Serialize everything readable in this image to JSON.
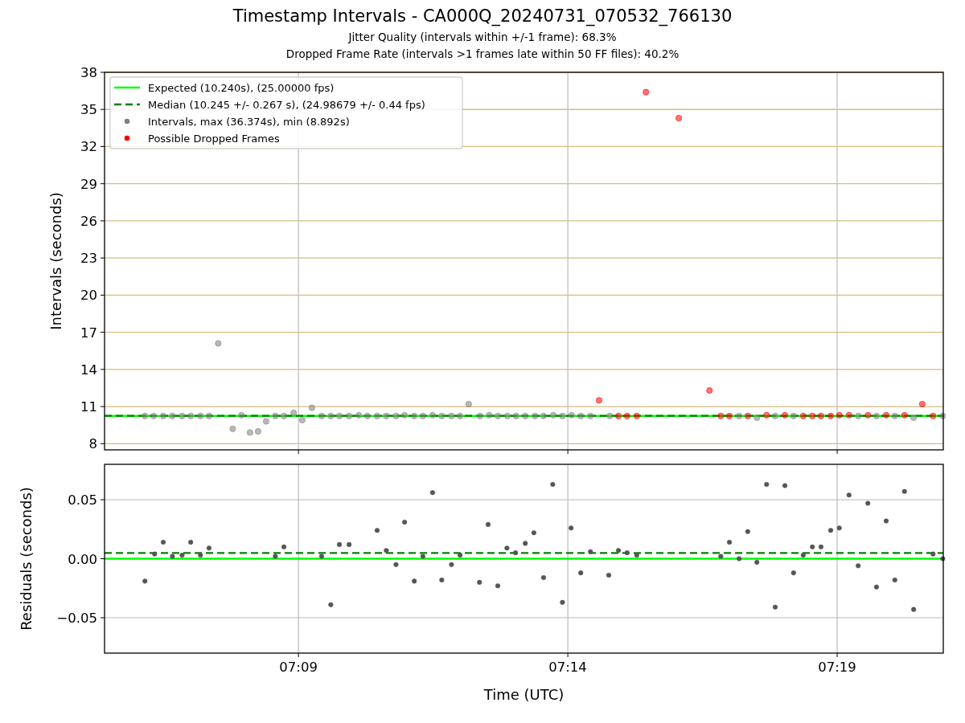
{
  "figure": {
    "title": "Timestamp Intervals - CA000Q_20240731_070532_766130",
    "subtitles": [
      "Jitter Quality (intervals within +/-1 frame): 68.3%",
      "Dropped Frame Rate (intervals >1 frames late within 50 FF files): 40.2%"
    ]
  },
  "panels": [
    {
      "chart_data": {
        "type": "scatter",
        "ylabel": "Intervals (seconds)",
        "grid": true,
        "legend": "upper left",
        "xlim": [
          425.4,
          440.97
        ],
        "ylim": [
          7.5,
          38
        ],
        "yticks": [
          {
            "value": 8,
            "label": "8"
          },
          {
            "value": 11,
            "label": "11"
          },
          {
            "value": 14,
            "label": "14"
          },
          {
            "value": 17,
            "label": "17"
          },
          {
            "value": 20,
            "label": "20"
          },
          {
            "value": 23,
            "label": "23"
          },
          {
            "value": 26,
            "label": "26"
          },
          {
            "value": 29,
            "label": "29"
          },
          {
            "value": 32,
            "label": "32"
          },
          {
            "value": 35,
            "label": "35"
          },
          {
            "value": 38,
            "label": "38"
          }
        ],
        "ref_lines": [
          {
            "axis": "y",
            "value": 10.24,
            "label": "Expected (10.240s), (25.00000 fps)",
            "color": "#00ff00"
          },
          {
            "axis": "y",
            "value": 10.245,
            "label": "Median (10.245 +/- 0.267 s), (24.98679 +/- 0.44 fps)",
            "color": "#008000"
          }
        ],
        "series": [
          {
            "name": "Intervals, max (36.374s), min (8.892s)",
            "color": "#808080",
            "x": [
              426.15,
              426.31,
              426.49,
              426.66,
              426.84,
              427.0,
              427.18,
              427.34,
              427.51,
              427.78,
              427.94,
              428.1,
              428.25,
              428.4,
              428.57,
              428.73,
              428.91,
              429.07,
              429.25,
              429.43,
              429.6,
              429.76,
              429.94,
              430.12,
              430.28,
              430.46,
              430.63,
              430.81,
              430.97,
              431.15,
              431.31,
              431.49,
              431.66,
              431.84,
              432.0,
              432.16,
              432.37,
              432.54,
              432.7,
              432.88,
              433.04,
              433.21,
              433.39,
              433.55,
              433.73,
              433.9,
              434.07,
              434.24,
              434.42,
              434.78,
              437.18,
              437.51,
              437.85,
              438.19,
              439.39,
              439.73,
              440.07,
              440.42,
              440.96
            ],
            "values": [
              10.24,
              10.24,
              10.24,
              10.24,
              10.24,
              10.24,
              10.24,
              10.24,
              16.1,
              9.2,
              10.3,
              8.9,
              9.0,
              9.8,
              10.24,
              10.24,
              10.5,
              9.9,
              10.9,
              10.24,
              10.24,
              10.24,
              10.24,
              10.3,
              10.24,
              10.24,
              10.24,
              10.24,
              10.3,
              10.24,
              10.24,
              10.3,
              10.24,
              10.24,
              10.24,
              11.2,
              10.24,
              10.3,
              10.24,
              10.24,
              10.24,
              10.24,
              10.24,
              10.24,
              10.3,
              10.24,
              10.3,
              10.24,
              10.24,
              10.24,
              10.24,
              10.1,
              10.24,
              10.24,
              10.24,
              10.24,
              10.24,
              10.1,
              10.24
            ]
          },
          {
            "name": "Possible Dropped Frames",
            "color": "#ff0000",
            "x": [
              434.58,
              434.94,
              435.1,
              435.28,
              435.45,
              436.06,
              436.63,
              436.84,
              437.0,
              437.34,
              437.69,
              438.03,
              438.37,
              438.54,
              438.7,
              438.88,
              439.04,
              439.22,
              439.57,
              439.91,
              440.25,
              440.58,
              440.78
            ],
            "values": [
              11.5,
              10.24,
              10.24,
              10.24,
              36.4,
              34.3,
              12.3,
              10.24,
              10.24,
              10.24,
              10.3,
              10.3,
              10.24,
              10.24,
              10.24,
              10.24,
              10.3,
              10.3,
              10.3,
              10.3,
              10.3,
              11.2,
              10.24
            ]
          }
        ]
      }
    },
    {
      "chart_data": {
        "type": "scatter",
        "xlabel": "Time (UTC)",
        "ylabel": "Residuals (seconds)",
        "grid": true,
        "xlim": [
          425.4,
          440.97
        ],
        "ylim": [
          -0.08,
          0.08
        ],
        "xticks": [
          {
            "value": 429,
            "label": "07:09"
          },
          {
            "value": 434,
            "label": "07:14"
          },
          {
            "value": 439,
            "label": "07:19"
          }
        ],
        "yticks": [
          {
            "value": -0.05,
            "label": "−0.05"
          },
          {
            "value": 0,
            "label": "0.00"
          },
          {
            "value": 0.05,
            "label": "0.05"
          }
        ],
        "ref_lines": [
          {
            "axis": "y",
            "value": 0,
            "color": "#00ff00"
          },
          {
            "axis": "y",
            "value": 0.0048,
            "color": "#008000"
          }
        ],
        "series": [
          {
            "color": "#555555",
            "x": [
              426.15,
              426.33,
              426.49,
              426.66,
              426.84,
              427.0,
              427.18,
              427.34,
              428.57,
              428.73,
              429.43,
              429.6,
              429.76,
              429.94,
              430.46,
              430.63,
              430.81,
              430.97,
              431.15,
              431.31,
              431.49,
              431.66,
              431.84,
              432.0,
              432.36,
              432.52,
              432.7,
              432.87,
              433.03,
              433.21,
              433.37,
              433.55,
              433.72,
              433.9,
              434.06,
              434.24,
              434.42,
              434.76,
              434.94,
              435.1,
              435.28,
              436.84,
              437.0,
              437.18,
              437.34,
              437.51,
              437.69,
              437.85,
              438.03,
              438.19,
              438.37,
              438.54,
              438.7,
              438.88,
              439.04,
              439.22,
              439.39,
              439.57,
              439.73,
              439.91,
              440.07,
              440.25,
              440.42,
              440.78,
              440.96
            ],
            "values": [
              -0.019,
              0.004,
              0.014,
              0.002,
              0.003,
              0.014,
              0.003,
              0.009,
              0.002,
              0.01,
              0.002,
              -0.039,
              0.012,
              0.012,
              0.024,
              0.007,
              -0.005,
              0.031,
              -0.019,
              0.002,
              0.056,
              -0.018,
              -0.005,
              0.003,
              -0.02,
              0.029,
              -0.023,
              0.009,
              0.005,
              0.013,
              0.022,
              -0.016,
              0.063,
              -0.037,
              0.026,
              -0.012,
              0.006,
              -0.014,
              0.007,
              0.005,
              0.003,
              0.002,
              0.014,
              0.0,
              0.023,
              -0.003,
              0.063,
              -0.041,
              0.062,
              -0.012,
              0.003,
              0.01,
              0.01,
              0.024,
              0.026,
              0.054,
              -0.006,
              0.047,
              -0.024,
              0.032,
              -0.018,
              0.057,
              -0.043,
              0.004,
              0.0
            ]
          }
        ]
      }
    }
  ]
}
